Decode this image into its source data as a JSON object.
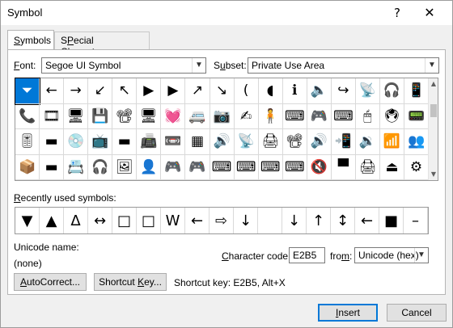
{
  "window": {
    "title": "Symbol",
    "help_label": "?",
    "close_label": "✕"
  },
  "tabs": [
    {
      "label": "Symbols",
      "mnemonic": "S",
      "rest": "ymbols",
      "active": true
    },
    {
      "label": "Special Characters",
      "mnemonic": "P",
      "pre": "S",
      "rest": "ecial Characters",
      "active": false
    }
  ],
  "font": {
    "label_pre": "",
    "label_mnemonic": "F",
    "label_rest": "ont:",
    "value": "Segoe UI Symbol"
  },
  "subset": {
    "label_mnemonic": "u",
    "label_pre": "S",
    "label_rest": "bset:",
    "value": "Private Use Area"
  },
  "grid": {
    "selected_index": 0,
    "rows": [
      [
        "⏷",
        "←",
        "→",
        "↙",
        "↖",
        "▶",
        "▶",
        "↗",
        "↘",
        "(",
        "◖",
        "ℹ",
        "🔈",
        "↪",
        "📡",
        "🎧",
        "📱"
      ],
      [
        "📞",
        "🎞",
        "🖥",
        "💾",
        "📽",
        "🖥",
        "💓",
        "🚐",
        "📷",
        "✍",
        "🧍",
        "⌨",
        "🎮",
        "⌨",
        "🖱",
        "🖲",
        "📟"
      ],
      [
        "🎚",
        "▬",
        "💿",
        "📺",
        "▬",
        "📠",
        "📼",
        "▦",
        "🔊",
        "📡",
        "🖨",
        "📽",
        "🔊",
        "📲",
        "🔉",
        "📶",
        "👥"
      ],
      [
        "📦",
        "▬",
        "📇",
        "🎧",
        "🖼",
        "👤",
        "🎮",
        "🎮",
        "⌨",
        "⌨",
        "⌨",
        "⌨",
        "🔇",
        "▀",
        "🖨",
        "⏏",
        "⚙"
      ]
    ]
  },
  "recent": {
    "label": "Recently used symbols:",
    "label_mnemonic": "R",
    "label_rest": "ecently used symbols:",
    "symbols": [
      "▼",
      "▲",
      "Δ",
      "↔",
      "□",
      "□",
      "W",
      "←",
      "⇨",
      "↓",
      "",
      "↓",
      "↑",
      "↕",
      "←",
      "■",
      "–"
    ]
  },
  "unicode_name": {
    "label": "Unicode name:",
    "value": "(none)"
  },
  "character_code": {
    "label_mnemonic": "C",
    "label_rest": "haracter code:",
    "value": "E2B5"
  },
  "from": {
    "label_mnemonic": "m",
    "label_pre": "fro",
    "label_rest": ":",
    "value": "Unicode (hex)"
  },
  "buttons": {
    "autocorrect": {
      "mnemonic": "A",
      "rest": "utoCorrect..."
    },
    "shortcut_key": {
      "pre": "Shortcut ",
      "mnemonic": "K",
      "rest": "ey..."
    },
    "insert": {
      "mnemonic": "I",
      "rest": "nsert"
    },
    "cancel": "Cancel"
  },
  "shortcut_info": "Shortcut key: E2B5, Alt+X",
  "colors": {
    "selection": "#0078d7",
    "dialog_bg": "#f0f0f0",
    "panel_bg": "#ffffff"
  }
}
